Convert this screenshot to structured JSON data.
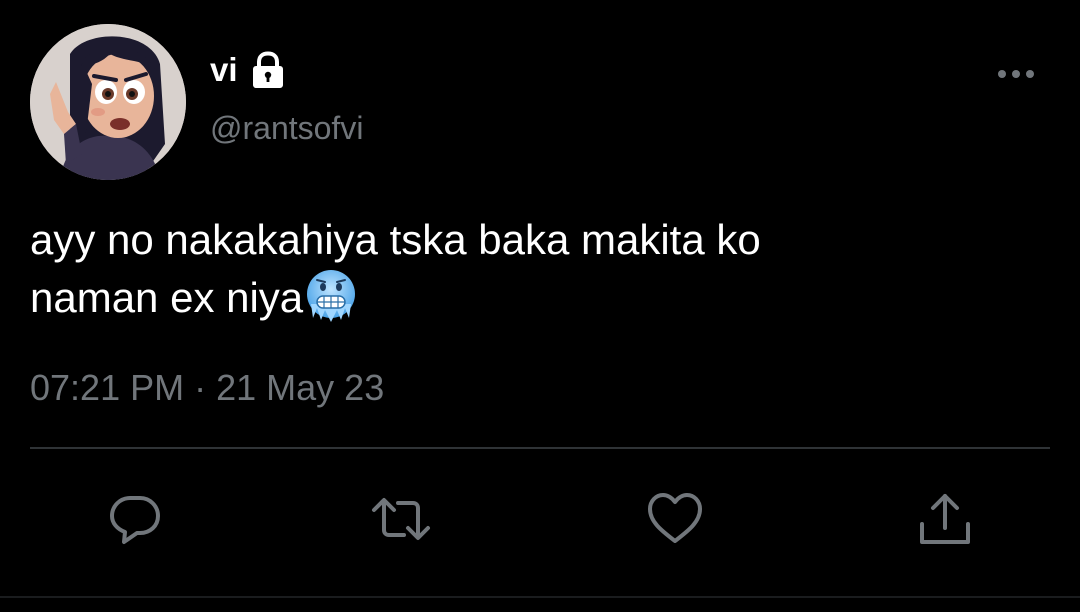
{
  "tweet": {
    "author": {
      "display_name": "vi",
      "handle": "@rantsofvi",
      "protected_icon": "lock-icon",
      "avatar": "cartoon-avatar"
    },
    "text_line1": "ayy no nakakahiya tska baka makita ko",
    "text_line2": "naman ex niya",
    "emoji": "cold-face-emoji",
    "time": "07:21 PM",
    "separator": "·",
    "date": "21 May 23",
    "menu_icon": "more-icon"
  },
  "actions": [
    {
      "icon": "reply-icon"
    },
    {
      "icon": "retweet-icon"
    },
    {
      "icon": "like-icon"
    },
    {
      "icon": "share-icon"
    }
  ],
  "colors": {
    "background": "#000000",
    "primary_text": "#ffffff",
    "secondary_text": "#71767b",
    "divider": "#2f3336"
  }
}
